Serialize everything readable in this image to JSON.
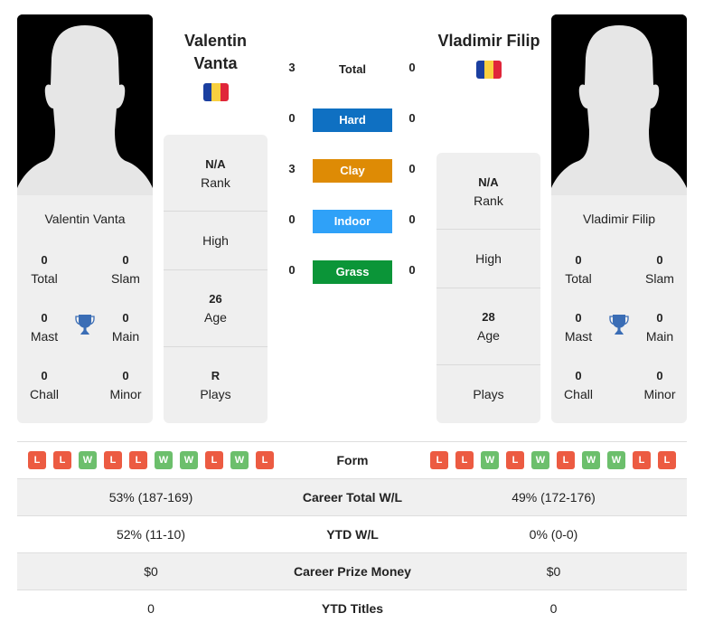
{
  "colors": {
    "hard": "#0f70c2",
    "clay": "#de8b05",
    "indoor": "#2fa1f8",
    "grass": "#0b9538",
    "win": "#6cbf6c",
    "loss": "#ec5b42",
    "trophy": "#3a6db5",
    "flag": [
      "#1b3fa0",
      "#f9d040",
      "#e0263a"
    ]
  },
  "player1": {
    "name": "Valentin Vanta",
    "name_lines": [
      "Valentin",
      "Vanta"
    ],
    "flag_icon": "romania-flag-icon",
    "card_name": "Valentin Vanta",
    "titles": {
      "total": {
        "value": "0",
        "label": "Total"
      },
      "slam": {
        "value": "0",
        "label": "Slam"
      },
      "mast": {
        "value": "0",
        "label": "Mast"
      },
      "main": {
        "value": "0",
        "label": "Main"
      },
      "chall": {
        "value": "0",
        "label": "Chall"
      },
      "minor": {
        "value": "0",
        "label": "Minor"
      }
    },
    "stats": {
      "rank": {
        "value": "N/A",
        "label": "Rank"
      },
      "high": {
        "value": "",
        "label": "High"
      },
      "age": {
        "value": "26",
        "label": "Age"
      },
      "plays": {
        "value": "R",
        "label": "Plays"
      }
    },
    "form": [
      "L",
      "L",
      "W",
      "L",
      "L",
      "W",
      "W",
      "L",
      "W",
      "L"
    ]
  },
  "player2": {
    "name": "Vladimir Filip",
    "flag_icon": "romania-flag-icon",
    "card_name": "Vladimir Filip",
    "titles": {
      "total": {
        "value": "0",
        "label": "Total"
      },
      "slam": {
        "value": "0",
        "label": "Slam"
      },
      "mast": {
        "value": "0",
        "label": "Mast"
      },
      "main": {
        "value": "0",
        "label": "Main"
      },
      "chall": {
        "value": "0",
        "label": "Chall"
      },
      "minor": {
        "value": "0",
        "label": "Minor"
      }
    },
    "stats": {
      "rank": {
        "value": "N/A",
        "label": "Rank"
      },
      "high": {
        "value": "",
        "label": "High"
      },
      "age": {
        "value": "28",
        "label": "Age"
      },
      "plays": {
        "value": "",
        "label": "Plays"
      }
    },
    "form": [
      "L",
      "L",
      "W",
      "L",
      "W",
      "L",
      "W",
      "W",
      "L",
      "L"
    ]
  },
  "h2h": {
    "total": {
      "label": "Total",
      "p1": "3",
      "p2": "0"
    },
    "hard": {
      "label": "Hard",
      "p1": "0",
      "p2": "0"
    },
    "clay": {
      "label": "Clay",
      "p1": "3",
      "p2": "0"
    },
    "indoor": {
      "label": "Indoor",
      "p1": "0",
      "p2": "0"
    },
    "grass": {
      "label": "Grass",
      "p1": "0",
      "p2": "0"
    }
  },
  "comparison": {
    "form_label": "Form",
    "rows": [
      {
        "label": "Career Total W/L",
        "p1": "53% (187-169)",
        "p2": "49% (172-176)"
      },
      {
        "label": "YTD W/L",
        "p1": "52% (11-10)",
        "p2": "0% (0-0)"
      },
      {
        "label": "Career Prize Money",
        "p1": "$0",
        "p2": "$0"
      },
      {
        "label": "YTD Titles",
        "p1": "0",
        "p2": "0"
      }
    ]
  }
}
